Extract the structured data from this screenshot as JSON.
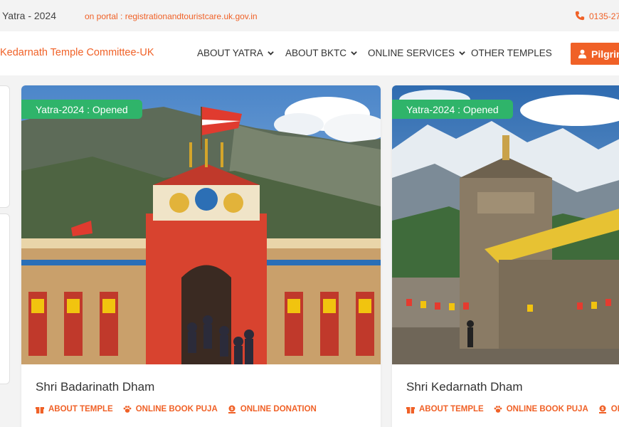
{
  "topbar": {
    "yatra_text": "Yatra - 2024",
    "portal_text": "on portal : registrationandtouristcare.uk.gov.in",
    "phone_text": "0135-27"
  },
  "nav": {
    "brand": "Kedarnath Temple Committee-UK",
    "menu": [
      {
        "label": "ABOUT YATRA"
      },
      {
        "label": "ABOUT BKTC"
      },
      {
        "label": "ONLINE SERVICES"
      },
      {
        "label": "OTHER TEMPLES"
      }
    ],
    "pilgrim_button": "Pilgrim"
  },
  "cards": [
    {
      "badge": "Yatra-2024 : Opened",
      "title": "Shri Badarinath Dham",
      "links": [
        "ABOUT TEMPLE",
        "ONLINE BOOK PUJA",
        "ONLINE DONATION"
      ]
    },
    {
      "badge": "Yatra-2024 : Opened",
      "title": "Shri Kedarnath Dham",
      "links": [
        "ABOUT TEMPLE",
        "ONLINE BOOK PUJA",
        "ONLINE DONATION"
      ]
    }
  ],
  "colors": {
    "accent": "#f06127",
    "badge_green": "#2fb46a"
  }
}
